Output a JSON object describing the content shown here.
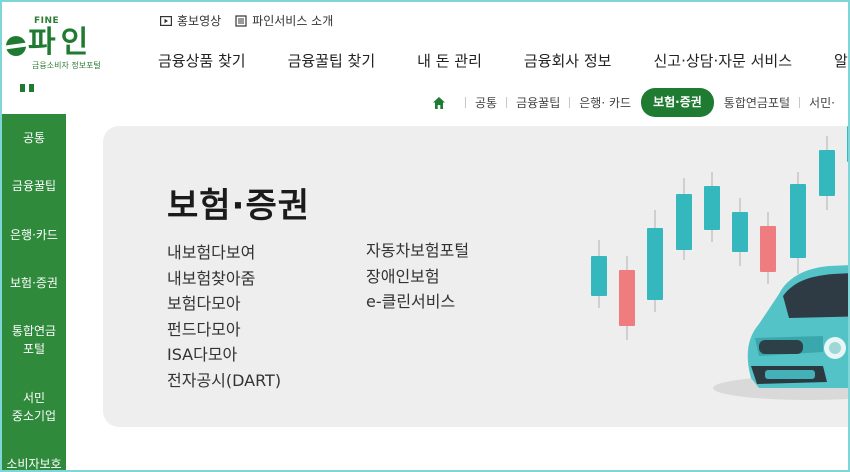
{
  "logo": {
    "fine": "FINE",
    "name": "파인",
    "subtitle": "금융소비자 정보포털"
  },
  "utility": [
    {
      "label": "홍보영상",
      "icon": "play-video-icon"
    },
    {
      "label": "파인서비스 소개",
      "icon": "document-list-icon"
    }
  ],
  "gnb": [
    "금융상품 찾기",
    "금융꿀팁 찾기",
    "내 돈 관리",
    "금융회사 정보",
    "신고·상담·자문 서비스",
    "알아두"
  ],
  "breadcrumb": {
    "home_icon": "home-icon",
    "items": [
      "공통",
      "금융꿀팁",
      "은행· 카드",
      "보험·증권",
      "통합연금포털",
      "서민·"
    ],
    "active": "보험·증권"
  },
  "sidebar": [
    "공통",
    "금융꿀팁",
    "은행·카드",
    "보험·증권",
    "통합연금\n포털",
    "서민\n중소기업",
    "소비자보호"
  ],
  "hero": {
    "title": "보험·증권",
    "links_col1": [
      "내보험다보여",
      "내보험찾아줌",
      "보험다모아",
      "펀드다모아",
      "ISA다모아",
      "전자공시(DART)"
    ],
    "links_col2": [
      "자동차보험포털",
      "장애인보험",
      "e-클린서비스"
    ],
    "illustration": "candlestick-chart-and-car-illustration"
  },
  "colors": {
    "brand_green": "#1f7a32",
    "sidebar_green": "#2f8a3c",
    "candle_teal": "#35b8bd",
    "candle_red": "#ef7c7f",
    "panel_bg": "#eeeeee"
  }
}
